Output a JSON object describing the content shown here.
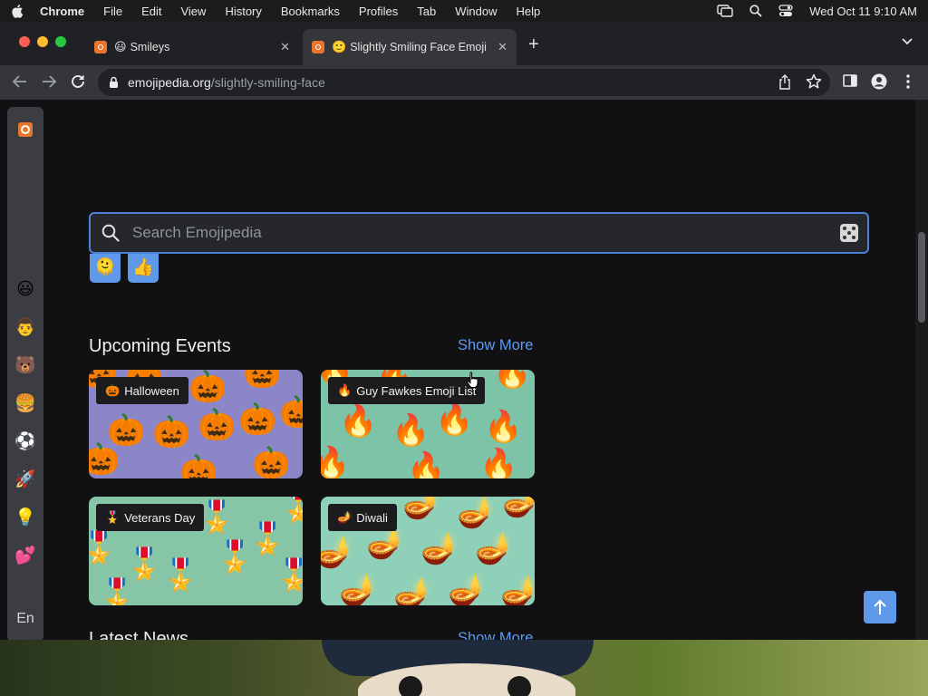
{
  "menubar": {
    "app": "Chrome",
    "items": [
      "File",
      "Edit",
      "View",
      "History",
      "Bookmarks",
      "Profiles",
      "Tab",
      "Window",
      "Help"
    ],
    "clock": "Wed Oct 11  9:10 AM"
  },
  "tabs": [
    {
      "emoji": "😃",
      "title": "Smileys",
      "close": "✕"
    },
    {
      "emoji": "🙂",
      "title": "Slightly Smiling Face Emoji",
      "close": "✕"
    }
  ],
  "newtab": "+",
  "omnibox": {
    "host": "emojipedia.org",
    "path": "/slightly-smiling-face"
  },
  "sidebar": {
    "items": [
      {
        "name": "smileys",
        "glyph": "😃"
      },
      {
        "name": "people",
        "glyph": "👨"
      },
      {
        "name": "animals",
        "glyph": "🐻"
      },
      {
        "name": "food",
        "glyph": "🍔"
      },
      {
        "name": "activities",
        "glyph": "⚽"
      },
      {
        "name": "travel",
        "glyph": "🚀"
      },
      {
        "name": "objects",
        "glyph": "💡"
      },
      {
        "name": "symbols",
        "glyph": "💕"
      }
    ],
    "language": "En"
  },
  "search": {
    "placeholder": "Search Emojipedia"
  },
  "quick_emojis": [
    "🫠",
    "👍"
  ],
  "upcoming": {
    "title": "Upcoming Events",
    "show_more": "Show More",
    "cards": [
      {
        "emoji": "🎃",
        "label": "Halloween",
        "pattern": "🎃"
      },
      {
        "emoji": "🔥",
        "label": "Guy Fawkes Emoji List",
        "pattern": "🔥"
      },
      {
        "emoji": "🎖️",
        "label": "Veterans Day",
        "pattern": "🎖️"
      },
      {
        "emoji": "🪔",
        "label": "Diwali",
        "pattern": "🪔"
      }
    ]
  },
  "latest": {
    "title": "Latest News",
    "show_more": "Show More"
  },
  "colors": {
    "accent": "#5e9ae9",
    "link": "#5b9bf3",
    "page_bg": "#111113"
  }
}
